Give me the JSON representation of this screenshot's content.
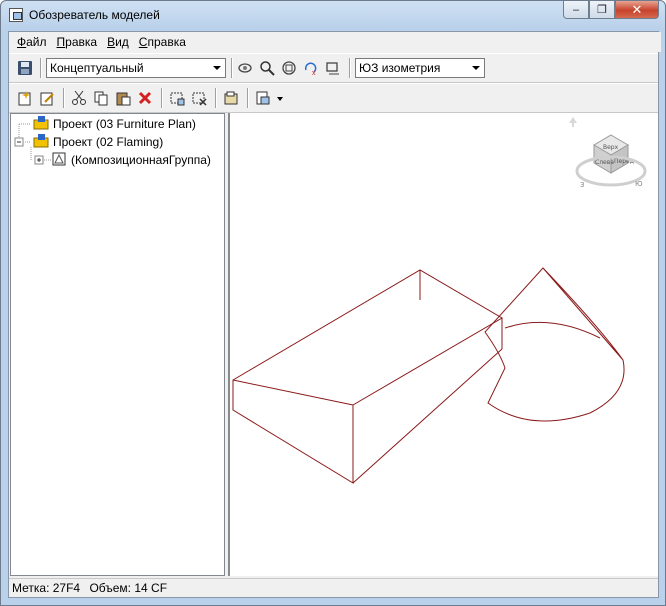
{
  "window": {
    "title": "Обозреватель моделей",
    "minimize": "–",
    "restore": "❐",
    "close": "✕"
  },
  "menu": {
    "items": [
      {
        "accel": "Ф",
        "rest": "айл"
      },
      {
        "accel": "П",
        "rest": "равка"
      },
      {
        "accel": "В",
        "rest": "ид"
      },
      {
        "accel": "С",
        "rest": "правка"
      }
    ]
  },
  "toolbar": {
    "visual_style": "Концептуальный",
    "view": "ЮЗ изометрия"
  },
  "tree": {
    "items": [
      {
        "label": "Проект (03 Furniture Plan)"
      },
      {
        "label": "Проект (02 Flaming)"
      },
      {
        "label": "(КомпозиционнаяГруппа)"
      }
    ]
  },
  "viewcube": {
    "top": "Верх",
    "left": "Слева",
    "front": "Перед"
  },
  "status": {
    "label_text": "Метка: 27F4",
    "volume_text": "Объем: 14 CF"
  },
  "colors": {
    "wireframe": "#8b1a1a",
    "delete": "#d42020",
    "accent": "#1e6fc9"
  }
}
